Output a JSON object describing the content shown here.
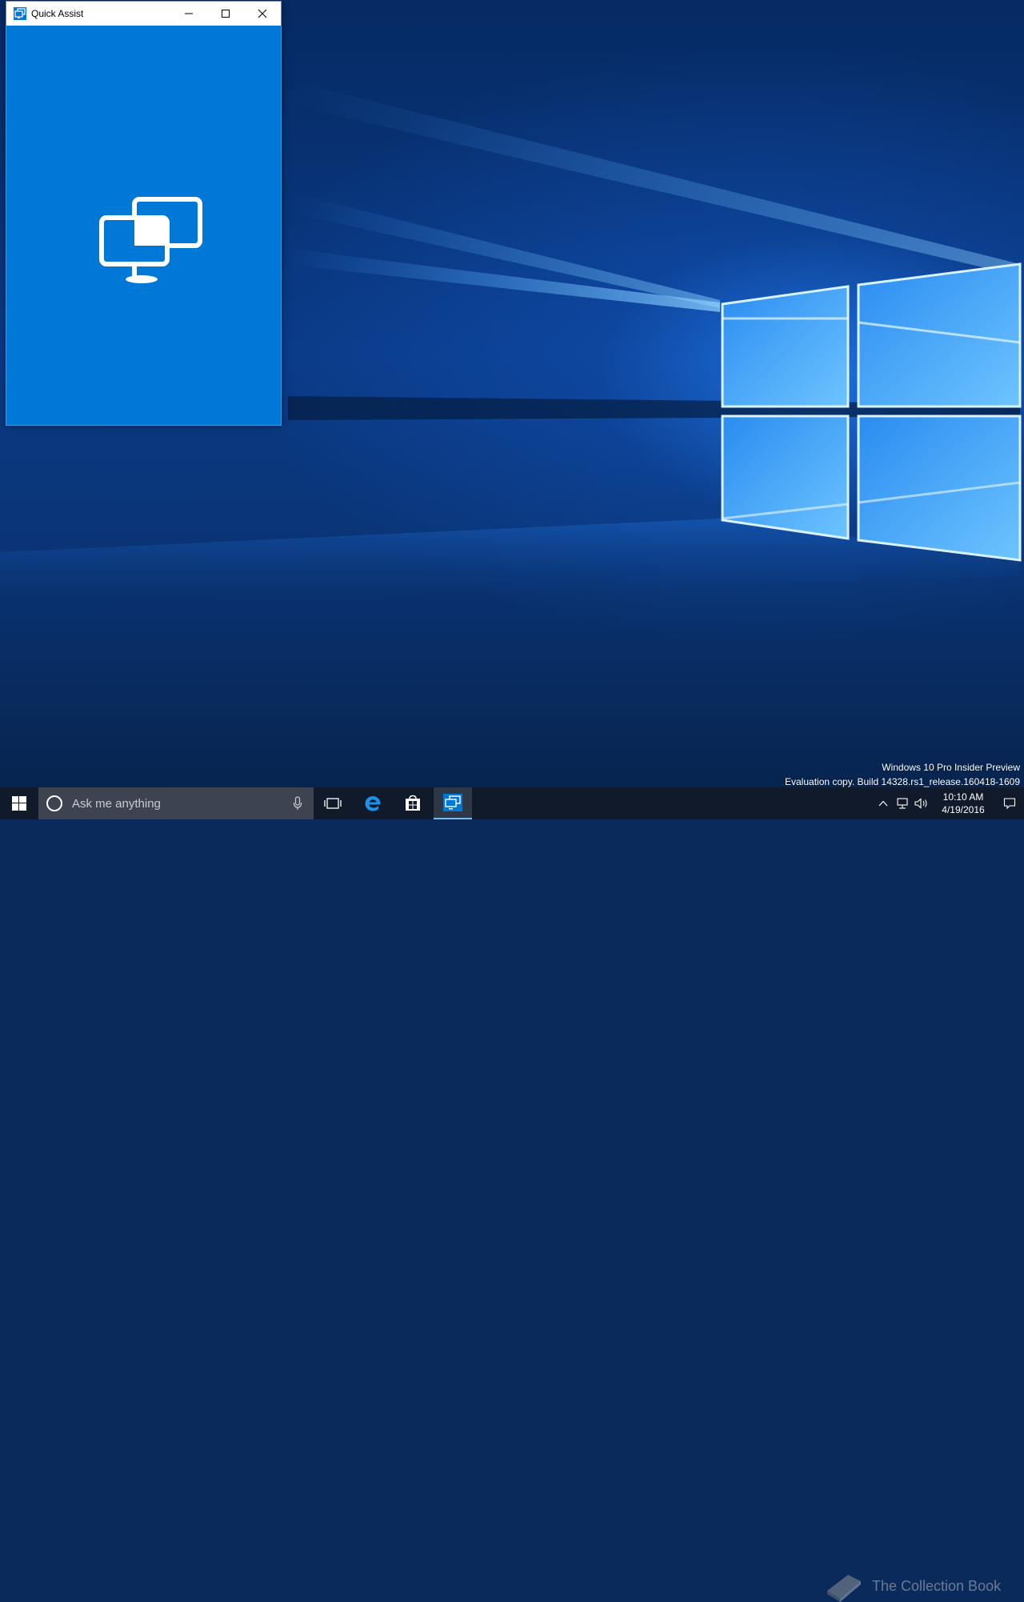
{
  "window": {
    "title": "Quick Assist",
    "app_icon": "quick-assist-icon",
    "splash_icon": "remote-desktop-icon",
    "controls": [
      "minimize-icon",
      "maximize-icon",
      "close-icon"
    ]
  },
  "desktop": {
    "watermark_line1": "Windows 10 Pro Insider Preview",
    "watermark_line2": "Evaluation copy. Build 14328.rs1_release.160418-1609"
  },
  "taskbar": {
    "search_placeholder": "Ask me anything",
    "pinned": [
      "task-view-icon",
      "edge-icon",
      "store-icon",
      "quick-assist-icon"
    ],
    "active_app": "Quick Assist",
    "tray_icons": [
      "chevron-up-icon",
      "network-icon",
      "volume-icon",
      "notification-icon"
    ],
    "time": "10:10 AM",
    "date": "4/19/2016"
  },
  "overlay": {
    "text": "The Collection Book"
  },
  "colors": {
    "accent": "#0078d7",
    "taskbar": "#101a2a",
    "search_box": "#3d4350"
  }
}
